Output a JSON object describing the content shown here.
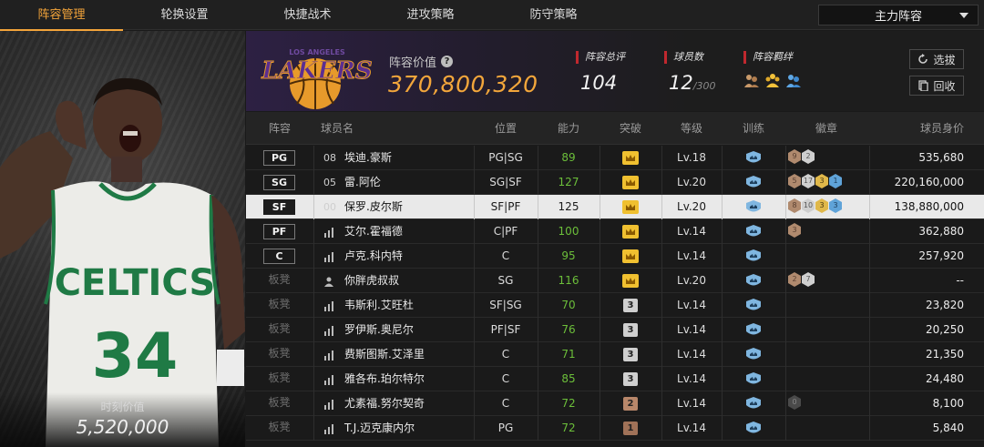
{
  "nav": {
    "tabs": [
      "阵容管理",
      "轮换设置",
      "快捷战术",
      "进攻策略",
      "防守策略"
    ],
    "active_tab": 0,
    "lineup_select": "主力阵容"
  },
  "player_card": {
    "value_label": "时刻价值",
    "value": "5,520,000"
  },
  "header": {
    "team_value_label": "阵容价值",
    "team_value": "370,800,320",
    "rating_label": "阵容总评",
    "rating": "104",
    "player_count_label": "球员数",
    "player_count": "12",
    "player_count_max": "/300",
    "chemistry_label": "阵容羁绊",
    "select_button": "选拔",
    "recycle_button": "回收"
  },
  "table": {
    "headers": [
      "阵容",
      "球员名",
      "位置",
      "能力",
      "突破",
      "等级",
      "训练",
      "徽章",
      "球员身价"
    ],
    "rows": [
      {
        "slot": "PG",
        "jersey": "08",
        "name": "埃迪.豪斯",
        "pos": "PG|SG",
        "ability": "89",
        "break": "crown",
        "level": "Lv.18",
        "badges": [
          {
            "n": "9",
            "t": "bronze"
          },
          {
            "n": "2",
            "t": "silver"
          }
        ],
        "price": "535,680",
        "selected": false,
        "starter": true
      },
      {
        "slot": "SG",
        "jersey": "05",
        "name": "雷.阿伦",
        "pos": "SG|SF",
        "ability": "127",
        "break": "crown",
        "level": "Lv.20",
        "badges": [
          {
            "n": "5",
            "t": "bronze"
          },
          {
            "n": "17",
            "t": "silver"
          },
          {
            "n": "3",
            "t": "gold"
          },
          {
            "n": "1",
            "t": "blue"
          }
        ],
        "price": "220,160,000",
        "selected": false,
        "starter": true
      },
      {
        "slot": "SF",
        "jersey": "00",
        "name": "保罗.皮尔斯",
        "pos": "SF|PF",
        "ability": "125",
        "break": "crown",
        "level": "Lv.20",
        "badges": [
          {
            "n": "8",
            "t": "bronze"
          },
          {
            "n": "10",
            "t": "silver"
          },
          {
            "n": "3",
            "t": "gold"
          },
          {
            "n": "3",
            "t": "blue"
          }
        ],
        "price": "138,880,000",
        "selected": true,
        "starter": true
      },
      {
        "slot": "PF",
        "jersey": "",
        "name": "艾尔.霍福德",
        "pos": "C|PF",
        "ability": "100",
        "break": "crown",
        "level": "Lv.14",
        "badges": [
          {
            "n": "3",
            "t": "bronze"
          }
        ],
        "price": "362,880",
        "selected": false,
        "starter": true
      },
      {
        "slot": "C",
        "jersey": "",
        "name": "卢克.科内特",
        "pos": "C",
        "ability": "95",
        "break": "crown",
        "level": "Lv.14",
        "badges": [],
        "price": "257,920",
        "selected": false,
        "starter": true
      },
      {
        "slot": "板凳",
        "jersey": "",
        "name": "你胖虎叔叔",
        "pos": "SG",
        "ability": "116",
        "break": "crown",
        "level": "Lv.20",
        "badges": [
          {
            "n": "2",
            "t": "bronze"
          },
          {
            "n": "7",
            "t": "silver"
          }
        ],
        "price": "--",
        "selected": false,
        "starter": false
      },
      {
        "slot": "板凳",
        "jersey": "",
        "name": "韦斯利.艾旺杜",
        "pos": "SF|SG",
        "ability": "70",
        "break": "3",
        "level": "Lv.14",
        "badges": [],
        "price": "23,820",
        "selected": false,
        "starter": false
      },
      {
        "slot": "板凳",
        "jersey": "",
        "name": "罗伊斯.奥尼尔",
        "pos": "PF|SF",
        "ability": "76",
        "break": "3",
        "level": "Lv.14",
        "badges": [],
        "price": "20,250",
        "selected": false,
        "starter": false
      },
      {
        "slot": "板凳",
        "jersey": "",
        "name": "费斯图斯.艾泽里",
        "pos": "C",
        "ability": "71",
        "break": "3",
        "level": "Lv.14",
        "badges": [],
        "price": "21,350",
        "selected": false,
        "starter": false
      },
      {
        "slot": "板凳",
        "jersey": "",
        "name": "雅各布.珀尔特尔",
        "pos": "C",
        "ability": "85",
        "break": "3",
        "level": "Lv.14",
        "badges": [],
        "price": "24,480",
        "selected": false,
        "starter": false
      },
      {
        "slot": "板凳",
        "jersey": "",
        "name": "尤素福.努尔契奇",
        "pos": "C",
        "ability": "72",
        "break": "2",
        "level": "Lv.14",
        "badges": [
          {
            "n": "0",
            "t": "dark"
          }
        ],
        "price": "8,100",
        "selected": false,
        "starter": false
      },
      {
        "slot": "板凳",
        "jersey": "",
        "name": "T.J.迈克康内尔",
        "pos": "PG",
        "ability": "72",
        "break": "1",
        "level": "Lv.14",
        "badges": [],
        "price": "5,840",
        "selected": false,
        "starter": false
      }
    ]
  },
  "colors": {
    "accent": "#f3a43a",
    "ability_green": "#6cbf3a",
    "stat_red": "#c0282e"
  },
  "icons": {
    "help": "question-circle-icon",
    "crown": "crown-icon",
    "training": "training-shield-icon",
    "select": "refresh-icon",
    "recycle": "recycle-icon"
  }
}
